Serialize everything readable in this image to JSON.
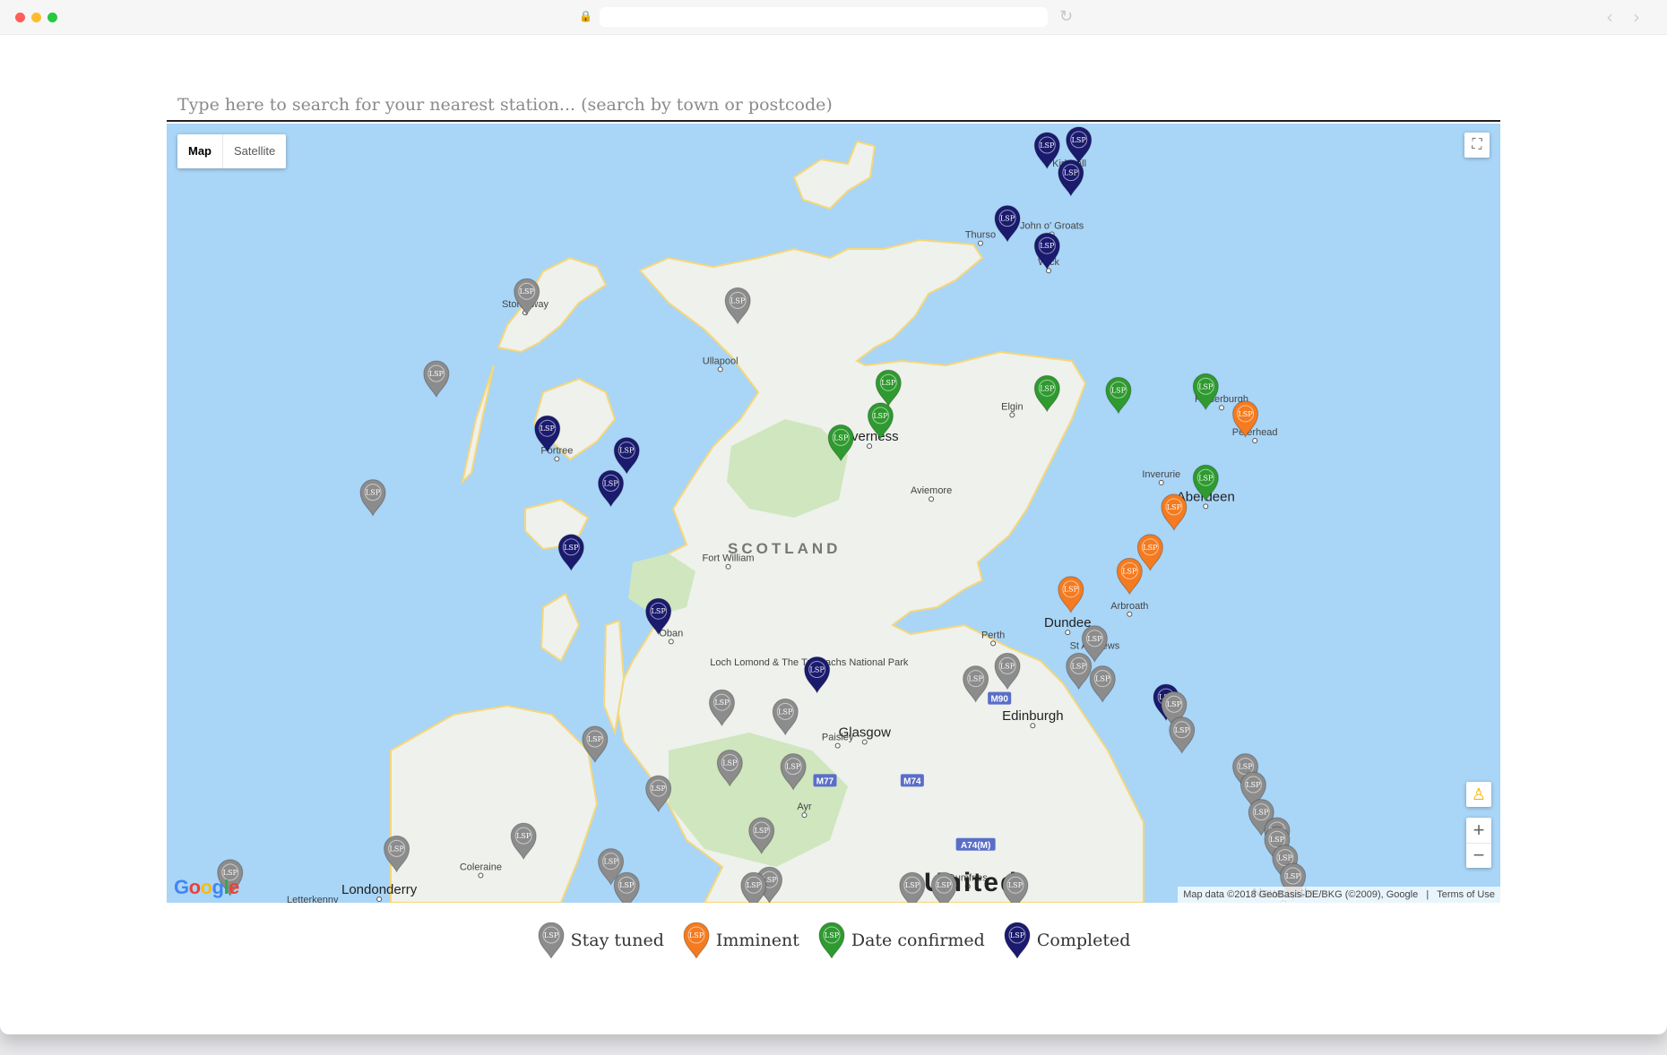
{
  "browser": {
    "traffic_lights": [
      "#fe5f57",
      "#febc2e",
      "#28c840"
    ]
  },
  "search": {
    "placeholder": "Type here to search for your nearest station... (search by town or postcode)"
  },
  "map": {
    "map_type": {
      "map_label": "Map",
      "satellite_label": "Satellite",
      "selected": "Map"
    },
    "attribution": "Map data ©2018 GeoBasis-DE/BKG (©2009), Google",
    "terms": "Terms of Use",
    "logo": "Google",
    "country_label": "SCOTLAND",
    "country_label_2": "United",
    "places": [
      {
        "name": "Kirkwall"
      },
      {
        "name": "Thurso"
      },
      {
        "name": "John o' Groats"
      },
      {
        "name": "Wick"
      },
      {
        "name": "Stornoway"
      },
      {
        "name": "Ullapool"
      },
      {
        "name": "Elgin"
      },
      {
        "name": "Fraserburgh"
      },
      {
        "name": "Peterhead"
      },
      {
        "name": "Inverness"
      },
      {
        "name": "Portree"
      },
      {
        "name": "Inverurie"
      },
      {
        "name": "Aberdeen"
      },
      {
        "name": "Aviemore"
      },
      {
        "name": "Fort William"
      },
      {
        "name": "Oban"
      },
      {
        "name": "Perth"
      },
      {
        "name": "Dundee"
      },
      {
        "name": "Arbroath"
      },
      {
        "name": "St Andrews"
      },
      {
        "name": "Loch Lomond & The Trossachs National Park"
      },
      {
        "name": "Glasgow"
      },
      {
        "name": "Edinburgh"
      },
      {
        "name": "Paisley"
      },
      {
        "name": "Ayr"
      },
      {
        "name": "Coleraine"
      },
      {
        "name": "Londonderry"
      },
      {
        "name": "Letterkenny"
      },
      {
        "name": "Dumfries"
      },
      {
        "name": "Newcastle"
      }
    ],
    "road_shields": [
      "M90",
      "M77",
      "M74",
      "A74(M)"
    ],
    "marker_label": "LSP",
    "markers": [
      {
        "status": "completed",
        "lat": 59.0,
        "lon": -3.1
      },
      {
        "status": "completed",
        "lat": 59.03,
        "lon": -2.9
      },
      {
        "status": "completed",
        "lat": 58.85,
        "lon": -2.95
      },
      {
        "status": "completed",
        "lat": 58.6,
        "lon": -3.35
      },
      {
        "status": "completed",
        "lat": 58.45,
        "lon": -3.1
      },
      {
        "status": "stay_tuned",
        "lat": 58.2,
        "lon": -6.38
      },
      {
        "status": "stay_tuned",
        "lat": 58.15,
        "lon": -5.05
      },
      {
        "status": "stay_tuned",
        "lat": 57.75,
        "lon": -6.95
      },
      {
        "status": "date_confirmed",
        "lat": 57.7,
        "lon": -4.1
      },
      {
        "status": "date_confirmed",
        "lat": 57.67,
        "lon": -3.1
      },
      {
        "status": "date_confirmed",
        "lat": 57.66,
        "lon": -2.65
      },
      {
        "status": "date_confirmed",
        "lat": 57.68,
        "lon": -2.1
      },
      {
        "status": "imminent",
        "lat": 57.53,
        "lon": -1.85
      },
      {
        "status": "date_confirmed",
        "lat": 57.52,
        "lon": -4.15
      },
      {
        "status": "date_confirmed",
        "lat": 57.4,
        "lon": -4.4
      },
      {
        "status": "completed",
        "lat": 57.45,
        "lon": -6.25
      },
      {
        "status": "completed",
        "lat": 57.33,
        "lon": -5.75
      },
      {
        "status": "completed",
        "lat": 57.15,
        "lon": -5.85
      },
      {
        "status": "stay_tuned",
        "lat": 57.1,
        "lon": -7.35
      },
      {
        "status": "date_confirmed",
        "lat": 57.18,
        "lon": -2.1
      },
      {
        "status": "imminent",
        "lat": 57.02,
        "lon": -2.3
      },
      {
        "status": "imminent",
        "lat": 56.8,
        "lon": -2.45
      },
      {
        "status": "imminent",
        "lat": 56.67,
        "lon": -2.58
      },
      {
        "status": "imminent",
        "lat": 56.57,
        "lon": -2.95
      },
      {
        "status": "completed",
        "lat": 56.8,
        "lon": -6.1
      },
      {
        "status": "completed",
        "lat": 56.45,
        "lon": -5.55
      },
      {
        "status": "completed",
        "lat": 56.13,
        "lon": -4.55
      },
      {
        "status": "stay_tuned",
        "lat": 56.3,
        "lon": -2.8
      },
      {
        "status": "stay_tuned",
        "lat": 56.15,
        "lon": -3.35
      },
      {
        "status": "stay_tuned",
        "lat": 56.08,
        "lon": -3.55
      },
      {
        "status": "stay_tuned",
        "lat": 56.15,
        "lon": -2.9
      },
      {
        "status": "stay_tuned",
        "lat": 56.08,
        "lon": -2.75
      },
      {
        "status": "completed",
        "lat": 55.98,
        "lon": -2.35
      },
      {
        "status": "stay_tuned",
        "lat": 55.94,
        "lon": -2.3
      },
      {
        "status": "stay_tuned",
        "lat": 55.8,
        "lon": -2.25
      },
      {
        "status": "stay_tuned",
        "lat": 55.95,
        "lon": -5.15
      },
      {
        "status": "stay_tuned",
        "lat": 55.9,
        "lon": -4.75
      },
      {
        "status": "stay_tuned",
        "lat": 55.75,
        "lon": -5.95
      },
      {
        "status": "stay_tuned",
        "lat": 55.62,
        "lon": -5.1
      },
      {
        "status": "stay_tuned",
        "lat": 55.6,
        "lon": -4.7
      },
      {
        "status": "stay_tuned",
        "lat": 55.48,
        "lon": -5.55
      },
      {
        "status": "stay_tuned",
        "lat": 55.6,
        "lon": -1.85
      },
      {
        "status": "stay_tuned",
        "lat": 55.5,
        "lon": -1.8
      },
      {
        "status": "stay_tuned",
        "lat": 55.35,
        "lon": -1.75
      },
      {
        "status": "stay_tuned",
        "lat": 55.25,
        "lon": -1.65
      },
      {
        "status": "stay_tuned",
        "lat": 55.2,
        "lon": -1.65
      },
      {
        "status": "stay_tuned",
        "lat": 55.1,
        "lon": -1.6
      },
      {
        "status": "stay_tuned",
        "lat": 55.0,
        "lon": -1.55
      },
      {
        "status": "stay_tuned",
        "lat": 55.25,
        "lon": -4.9
      },
      {
        "status": "stay_tuned",
        "lat": 55.22,
        "lon": -6.4
      },
      {
        "status": "stay_tuned",
        "lat": 55.15,
        "lon": -7.2
      },
      {
        "status": "stay_tuned",
        "lat": 55.08,
        "lon": -5.85
      },
      {
        "status": "stay_tuned",
        "lat": 55.02,
        "lon": -8.25
      },
      {
        "status": "stay_tuned",
        "lat": 54.95,
        "lon": -5.75
      },
      {
        "status": "stay_tuned",
        "lat": 54.98,
        "lon": -4.85
      },
      {
        "status": "stay_tuned",
        "lat": 54.95,
        "lon": -4.95
      },
      {
        "status": "stay_tuned",
        "lat": 54.95,
        "lon": -3.95
      },
      {
        "status": "stay_tuned",
        "lat": 54.95,
        "lon": -3.75
      },
      {
        "status": "stay_tuned",
        "lat": 54.95,
        "lon": -3.3
      }
    ]
  },
  "legend": [
    {
      "status": "stay_tuned",
      "label": "Stay tuned",
      "color": "#8c8c8c"
    },
    {
      "status": "imminent",
      "label": "Imminent",
      "color": "#f47b20"
    },
    {
      "status": "date_confirmed",
      "label": "Date confirmed",
      "color": "#2f9a2f"
    },
    {
      "status": "completed",
      "label": "Completed",
      "color": "#1a1a6e"
    }
  ],
  "colors": {
    "sea": "#a9d5f7",
    "land": "#eef1ec",
    "park": "#cfe6bf",
    "coast": "#f5d77a"
  }
}
